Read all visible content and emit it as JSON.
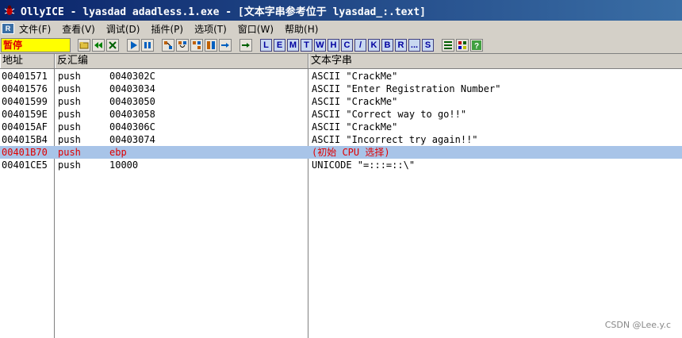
{
  "window": {
    "title": "OllyICE - lyasdad adadless.1.exe - [文本字串参考位于 lyasdad_:.text]"
  },
  "menubar": {
    "sys_label": "R",
    "items": [
      "文件(F)",
      "查看(V)",
      "调试(D)",
      "插件(P)",
      "选项(T)",
      "窗口(W)",
      "帮助(H)"
    ]
  },
  "toolbar": {
    "status": "暂停",
    "letters": [
      "L",
      "E",
      "M",
      "T",
      "W",
      "H",
      "C",
      "/",
      "K",
      "B",
      "R",
      "...",
      "S"
    ]
  },
  "table": {
    "headers": [
      "地址",
      "反汇编",
      "文本字串"
    ],
    "rows": [
      {
        "addr": "00401571",
        "op": "push",
        "arg": "0040302C",
        "text": "ASCII \"CrackMe\""
      },
      {
        "addr": "00401576",
        "op": "push",
        "arg": "00403034",
        "text": "ASCII \"Enter Registration Number\""
      },
      {
        "addr": "00401599",
        "op": "push",
        "arg": "00403050",
        "text": "ASCII \"CrackMe\""
      },
      {
        "addr": "0040159E",
        "op": "push",
        "arg": "00403058",
        "text": "ASCII \"Correct way to go!!\""
      },
      {
        "addr": "004015AF",
        "op": "push",
        "arg": "0040306C",
        "text": "ASCII \"CrackMe\""
      },
      {
        "addr": "004015B4",
        "op": "push",
        "arg": "00403074",
        "text": "ASCII \"Incorrect try again!!\""
      },
      {
        "addr": "00401B70",
        "op": "push",
        "arg": "ebp",
        "text": "(初始 CPU 选择)"
      },
      {
        "addr": "00401CE5",
        "op": "push",
        "arg": "10000",
        "text": "UNICODE \"=:::=::\\\""
      }
    ]
  },
  "watermark": "CSDN @Lee.y.c"
}
